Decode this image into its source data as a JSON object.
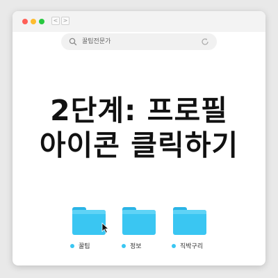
{
  "window": {
    "controls": {
      "close_color": "#ff5f57",
      "minimize_color": "#febc2e",
      "zoom_color": "#28c840"
    },
    "nav": {
      "back": "<",
      "forward": ">"
    }
  },
  "search": {
    "text": "꿀팁전문가",
    "icon": "search-icon",
    "reload_icon": "reload-icon"
  },
  "headline": {
    "line1": "2단계: 프로필",
    "line2": "아이콘 클릭하기"
  },
  "folders": [
    {
      "label": "꿀팁",
      "icon": "folder-icon"
    },
    {
      "label": "정보",
      "icon": "folder-icon"
    },
    {
      "label": "직박구리",
      "icon": "folder-icon"
    }
  ],
  "accent_color": "#3ac6f2",
  "cursor": "mouse-pointer-icon"
}
